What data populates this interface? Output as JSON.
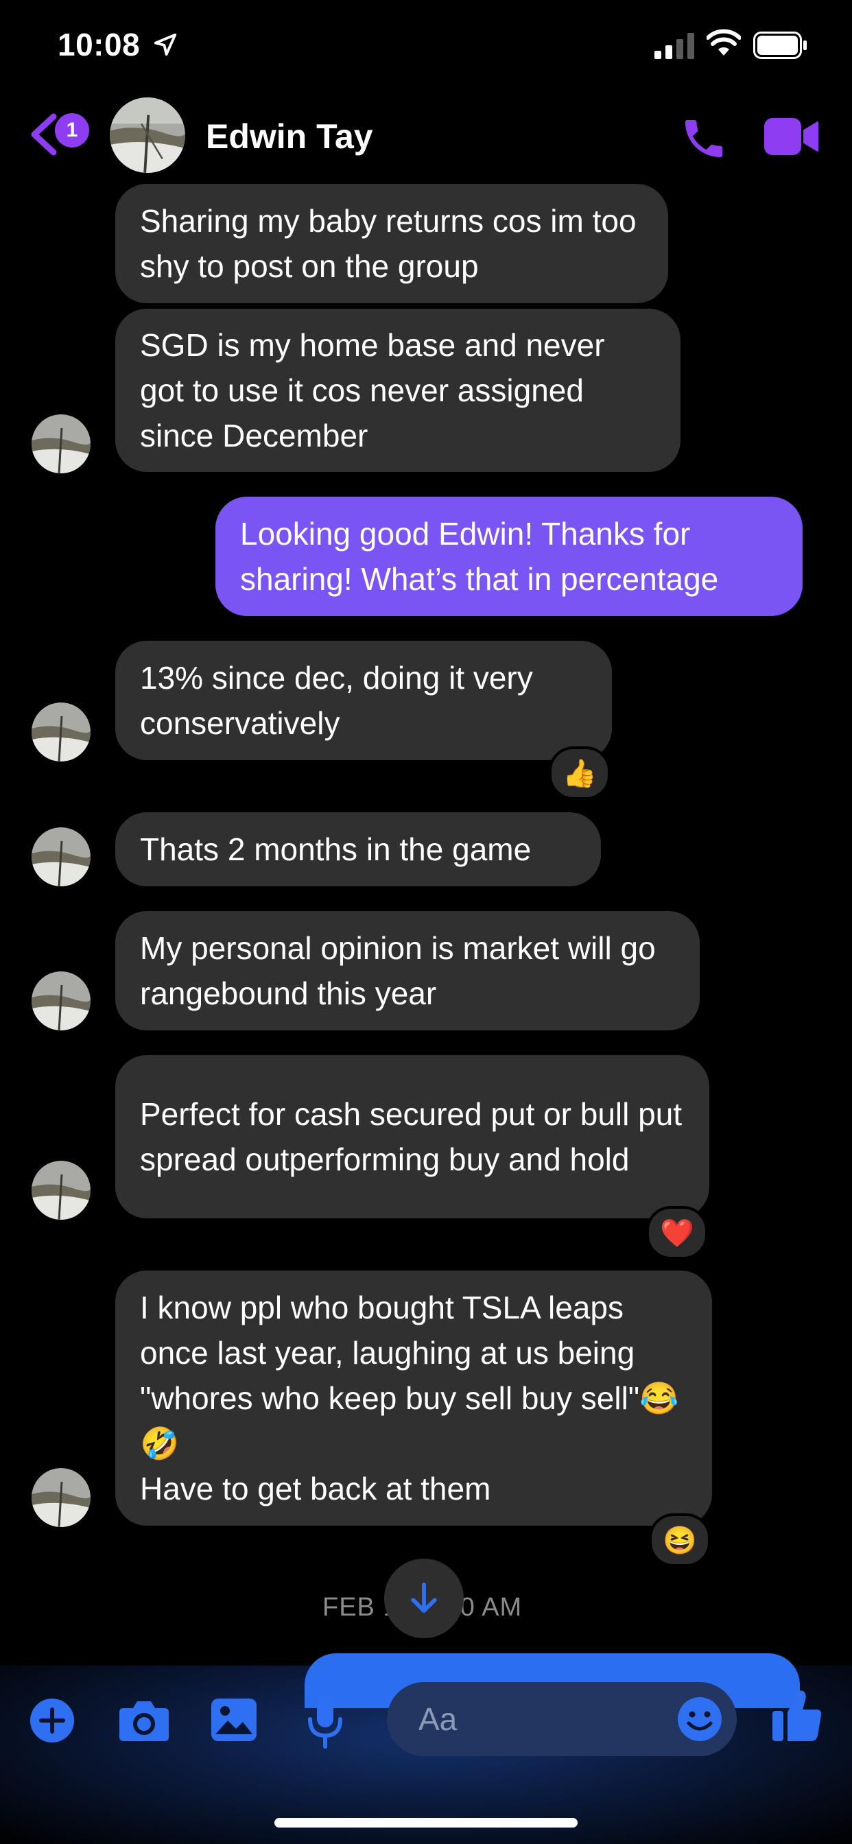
{
  "status_bar": {
    "time": "10:08"
  },
  "header": {
    "unread_count": "1",
    "contact_name": "Edwin Tay"
  },
  "messages": [
    {
      "from": "them",
      "text": "Sharing my baby returns cos im too shy to post on the group"
    },
    {
      "from": "them",
      "text": "SGD is my home base and never got to use it cos never assigned since December"
    },
    {
      "from": "me",
      "text": "Looking good Edwin! Thanks for sharing! What’s that in percentage"
    },
    {
      "from": "them",
      "text": "13% since dec, doing it very conservatively",
      "reaction": "👍"
    },
    {
      "from": "them",
      "text": "Thats 2 months in the game"
    },
    {
      "from": "them",
      "text": "My personal opinion is market will go rangebound this year"
    },
    {
      "from": "them",
      "text": "Perfect for cash secured put or bull put spread outperforming buy and hold",
      "reaction": "❤️"
    },
    {
      "from": "them",
      "text": "I know ppl who bought TSLA leaps once last year, laughing at us being \"whores who keep buy sell buy sell\"😂🤣\nHave to get back at them",
      "reaction": "😆"
    }
  ],
  "date_separator": "FEB 1",
  "date_separator_tail": "0 AM",
  "composer": {
    "placeholder": "Aa"
  },
  "colors": {
    "accent": "#8e3df3",
    "outgoing_bubble": "#7b55f4",
    "incoming_bubble": "#303030",
    "composer_icon": "#2f6ff2"
  }
}
